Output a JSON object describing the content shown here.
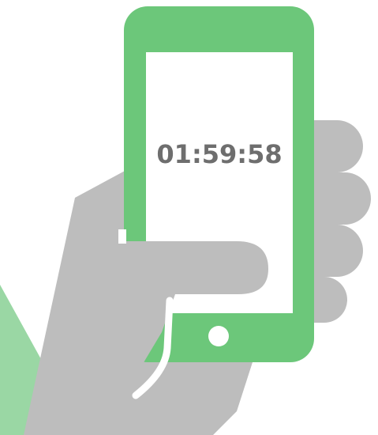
{
  "timer": {
    "display": "01:59:58"
  },
  "colors": {
    "phone_body": "#6cc77a",
    "screen": "#ffffff",
    "hand": "#bdbdbd",
    "sleeve": "#9ad7a4",
    "timer_text": "#6e6e6e",
    "home_button": "#ffffff",
    "finger_outline": "#ffffff"
  },
  "icons": {
    "illustration": "hand-holding-phone-icon",
    "home_button": "home-button-icon"
  }
}
